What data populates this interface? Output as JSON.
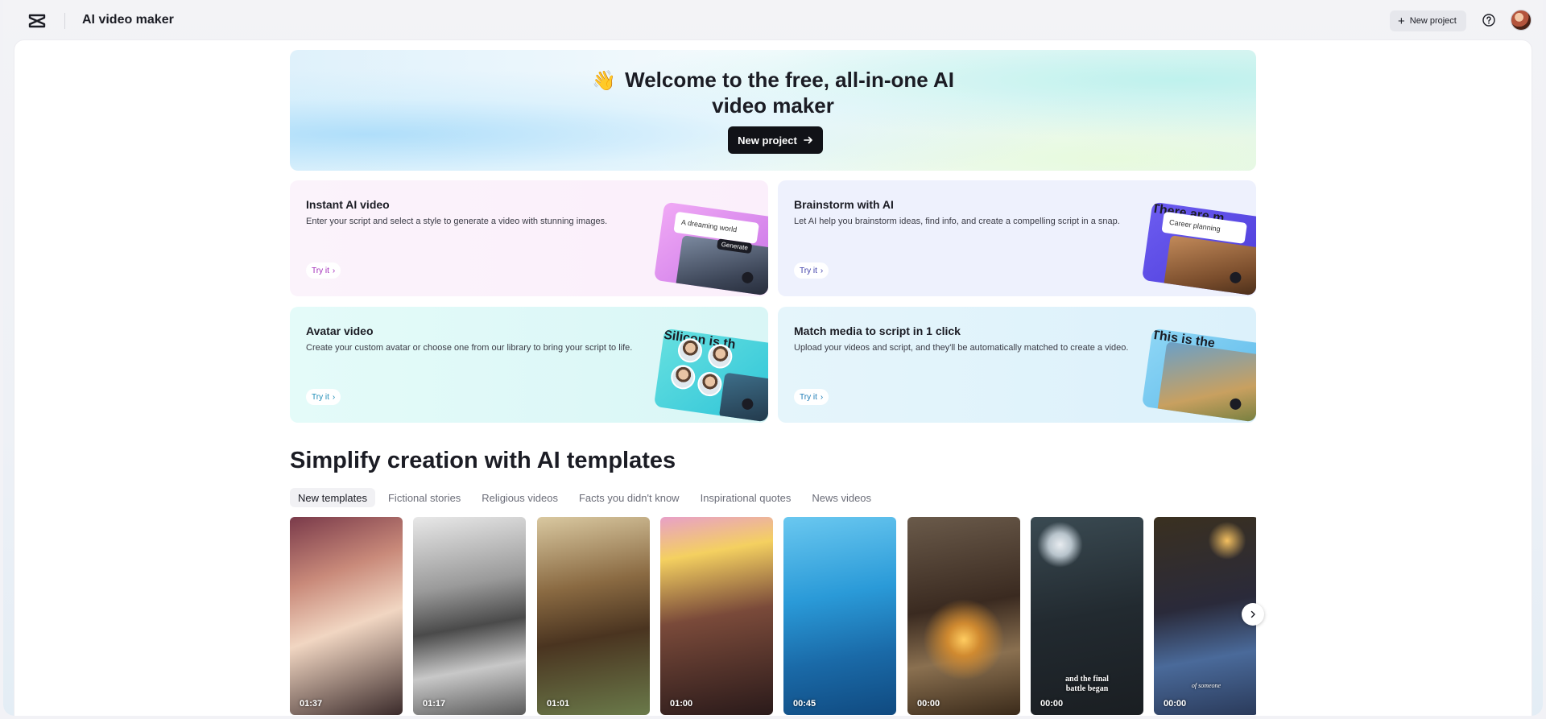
{
  "app": {
    "title": "AI video maker"
  },
  "topbar": {
    "new_project_label": "New project"
  },
  "hero": {
    "emoji": "👋",
    "title": "Welcome to the free, all-in-one AI video maker",
    "button_label": "New project"
  },
  "features": [
    {
      "title": "Instant AI video",
      "desc": "Enter your script and select a style to generate a video with stunning images.",
      "try_label": "Try it",
      "thumb_text": "A dreaming world",
      "thumb_button": "Generate"
    },
    {
      "title": "Brainstorm with AI",
      "desc": "Let AI help you brainstorm ideas, find info, and create a compelling script in a snap.",
      "try_label": "Try it",
      "thumb_text": "Career planning",
      "thumb_caption": "There are m"
    },
    {
      "title": "Avatar video",
      "desc": "Create your custom avatar or choose one from our library to bring your script to life.",
      "try_label": "Try it",
      "thumb_caption": "Silicon is th"
    },
    {
      "title": "Match media to script in 1 click",
      "desc": "Upload your videos and script, and they'll be automatically matched to create a video.",
      "try_label": "Try it",
      "thumb_caption": "This is the"
    }
  ],
  "templates": {
    "section_title": "Simplify creation with AI templates",
    "tabs": [
      "New templates",
      "Fictional stories",
      "Religious videos",
      "Facts you didn't know",
      "Inspirational quotes",
      "News videos"
    ],
    "active_tab": "New templates",
    "items": [
      {
        "duration": "01:37",
        "caption": ""
      },
      {
        "duration": "01:17",
        "caption": ""
      },
      {
        "duration": "01:01",
        "caption": ""
      },
      {
        "duration": "01:00",
        "caption": ""
      },
      {
        "duration": "00:45",
        "caption": ""
      },
      {
        "duration": "00:00",
        "caption": ""
      },
      {
        "duration": "00:00",
        "caption": "and the final battle began"
      },
      {
        "duration": "00:00",
        "caption": "of someone"
      }
    ]
  }
}
